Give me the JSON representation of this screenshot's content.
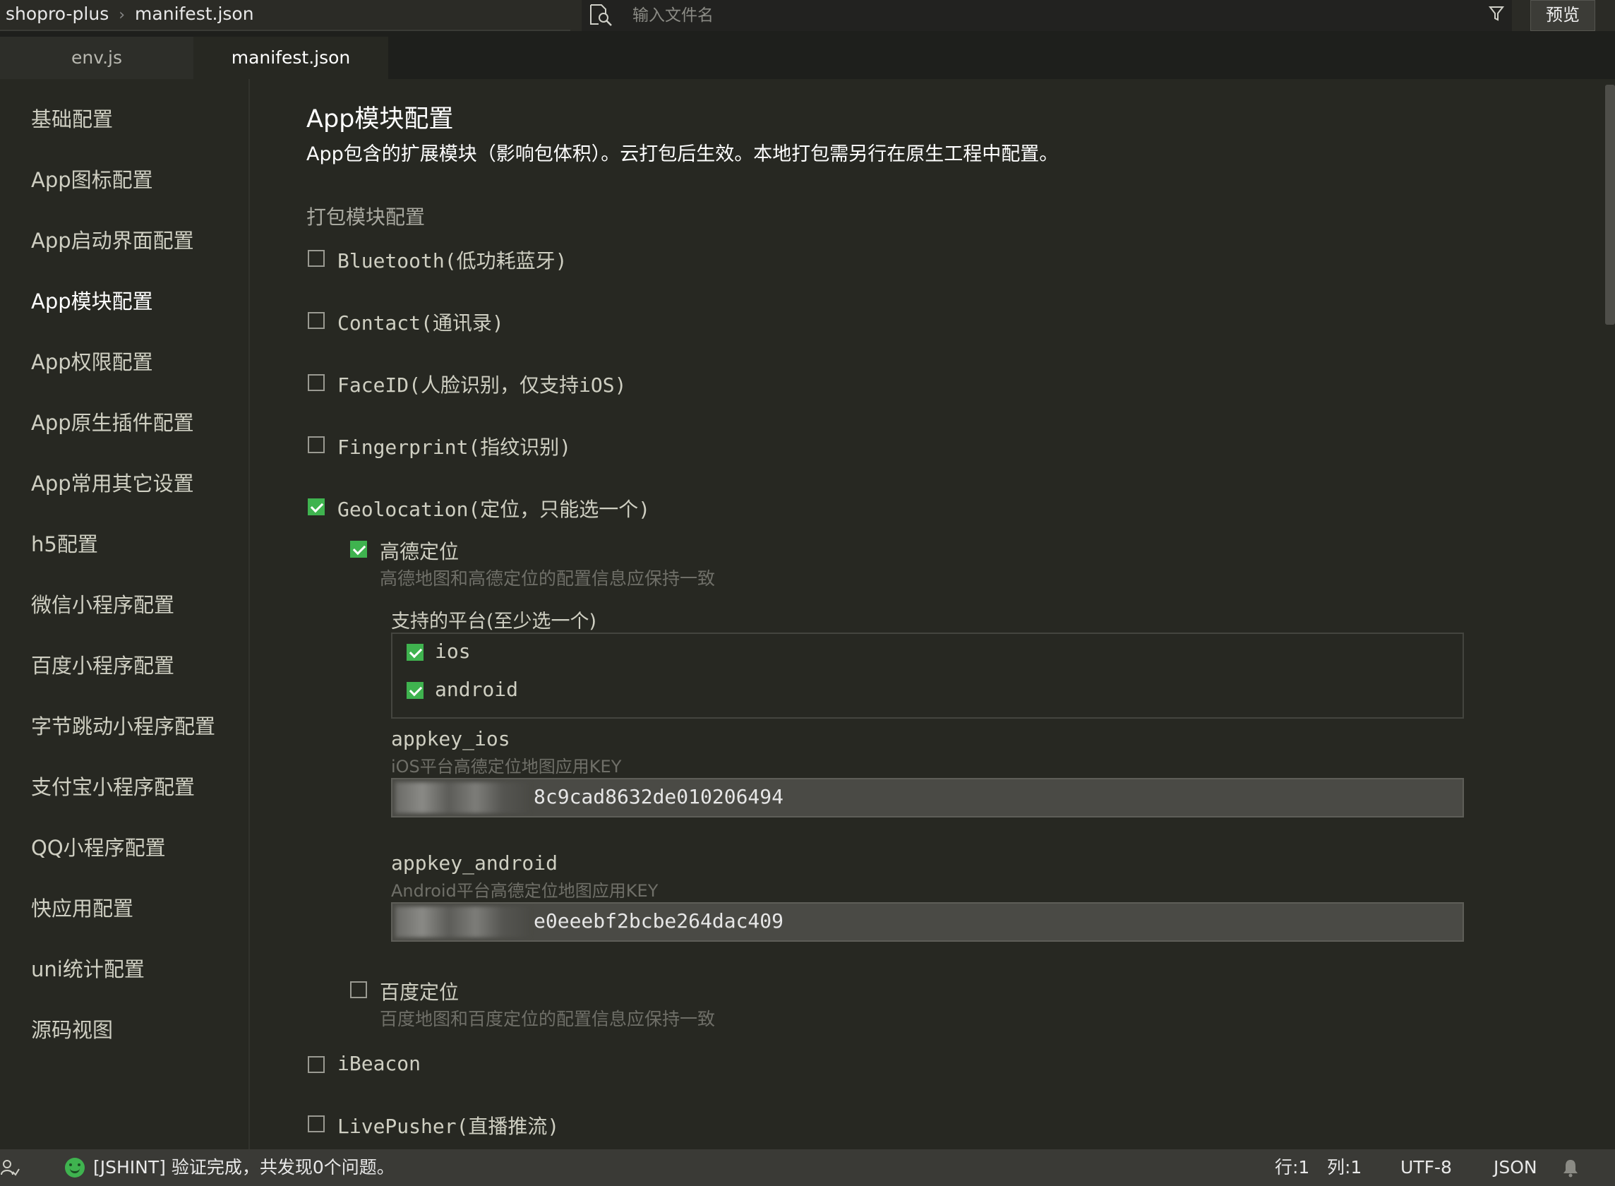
{
  "breadcrumb": {
    "project": "shopro-plus",
    "separator": "›",
    "file": "manifest.json"
  },
  "search": {
    "placeholder": "输入文件名"
  },
  "preview_label": "预览",
  "tabs": [
    {
      "label": "env.js"
    },
    {
      "label": "manifest.json"
    }
  ],
  "sidebar": {
    "active_index": 3,
    "items": [
      {
        "label": "基础配置"
      },
      {
        "label": "App图标配置"
      },
      {
        "label": "App启动界面配置"
      },
      {
        "label": "App模块配置"
      },
      {
        "label": "App权限配置"
      },
      {
        "label": "App原生插件配置"
      },
      {
        "label": "App常用其它设置"
      },
      {
        "label": "h5配置"
      },
      {
        "label": "微信小程序配置"
      },
      {
        "label": "百度小程序配置"
      },
      {
        "label": "字节跳动小程序配置"
      },
      {
        "label": "支付宝小程序配置"
      },
      {
        "label": "QQ小程序配置"
      },
      {
        "label": "快应用配置"
      },
      {
        "label": "uni统计配置"
      },
      {
        "label": "源码视图"
      }
    ]
  },
  "main": {
    "title": "App模块配置",
    "subtitle": "App包含的扩展模块（影响包体积）。云打包后生效。本地打包需另行在原生工程中配置。",
    "section_label": "打包模块配置",
    "modules": {
      "bluetooth": {
        "label": "Bluetooth(低功耗蓝牙)",
        "checked": false
      },
      "contact": {
        "label": "Contact(通讯录)",
        "checked": false
      },
      "faceid": {
        "label": "FaceID(人脸识别，仅支持iOS)",
        "checked": false
      },
      "fingerprint": {
        "label": "Fingerprint(指纹识别)",
        "checked": false
      },
      "geolocation": {
        "label": "Geolocation(定位，只能选一个)",
        "checked": true
      },
      "ibeacon": {
        "label": "iBeacon",
        "checked": false
      },
      "livepusher": {
        "label": "LivePusher(直播推流)",
        "checked": false
      }
    },
    "amap": {
      "label": "高德定位",
      "checked": true,
      "hint": "高德地图和高德定位的配置信息应保持一致",
      "platforms_label": "支持的平台(至少选一个)",
      "platforms": [
        {
          "label": "ios",
          "checked": true
        },
        {
          "label": "android",
          "checked": true
        }
      ],
      "appkey_ios": {
        "label": "appkey_ios",
        "hint": "iOS平台高德定位地图应用KEY",
        "value": "8c9cad8632de010206494"
      },
      "appkey_android": {
        "label": "appkey_android",
        "hint": "Android平台高德定位地图应用KEY",
        "value": "e0eeebf2bcbe264dac409"
      }
    },
    "baidu": {
      "label": "百度定位",
      "checked": false,
      "hint": "百度地图和百度定位的配置信息应保持一致"
    }
  },
  "statusbar": {
    "message": "[JSHINT] 验证完成，共发现0个问题。",
    "line": "行:1",
    "column": "列:1",
    "encoding": "UTF-8",
    "language": "JSON"
  },
  "colors": {
    "accent_green": "#3fb34f",
    "background": "#272822"
  }
}
